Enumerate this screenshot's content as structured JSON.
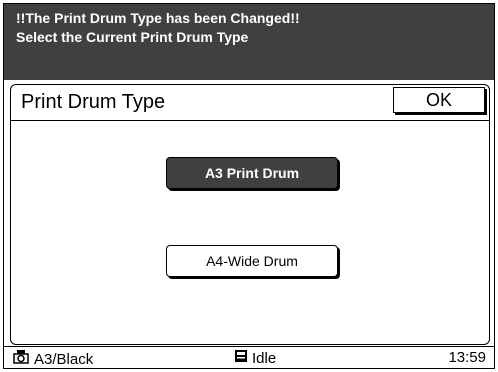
{
  "alert": {
    "line1": "!!The Print Drum Type has been Changed!!",
    "line2": "Select the Current Print Drum Type"
  },
  "panel": {
    "title": "Print Drum Type",
    "ok_label": "OK",
    "options": [
      {
        "label": "A3 Print Drum",
        "selected": true
      },
      {
        "label": "A4-Wide Drum",
        "selected": false
      }
    ]
  },
  "status": {
    "paper": "A3/Black",
    "paper_icon": "drum-icon",
    "state": "Idle",
    "state_icon": "machine-icon",
    "time": "13:59"
  },
  "colors": {
    "dark": "#404040",
    "light": "#ffffff"
  }
}
